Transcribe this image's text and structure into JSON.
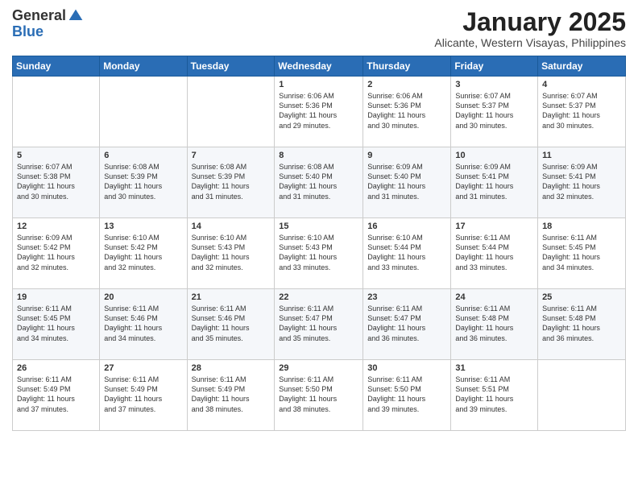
{
  "header": {
    "logo_line1": "General",
    "logo_line2": "Blue",
    "month": "January 2025",
    "location": "Alicante, Western Visayas, Philippines"
  },
  "weekdays": [
    "Sunday",
    "Monday",
    "Tuesday",
    "Wednesday",
    "Thursday",
    "Friday",
    "Saturday"
  ],
  "weeks": [
    [
      {
        "day": "",
        "info": ""
      },
      {
        "day": "",
        "info": ""
      },
      {
        "day": "",
        "info": ""
      },
      {
        "day": "1",
        "info": "Sunrise: 6:06 AM\nSunset: 5:36 PM\nDaylight: 11 hours\nand 29 minutes."
      },
      {
        "day": "2",
        "info": "Sunrise: 6:06 AM\nSunset: 5:36 PM\nDaylight: 11 hours\nand 30 minutes."
      },
      {
        "day": "3",
        "info": "Sunrise: 6:07 AM\nSunset: 5:37 PM\nDaylight: 11 hours\nand 30 minutes."
      },
      {
        "day": "4",
        "info": "Sunrise: 6:07 AM\nSunset: 5:37 PM\nDaylight: 11 hours\nand 30 minutes."
      }
    ],
    [
      {
        "day": "5",
        "info": "Sunrise: 6:07 AM\nSunset: 5:38 PM\nDaylight: 11 hours\nand 30 minutes."
      },
      {
        "day": "6",
        "info": "Sunrise: 6:08 AM\nSunset: 5:39 PM\nDaylight: 11 hours\nand 30 minutes."
      },
      {
        "day": "7",
        "info": "Sunrise: 6:08 AM\nSunset: 5:39 PM\nDaylight: 11 hours\nand 31 minutes."
      },
      {
        "day": "8",
        "info": "Sunrise: 6:08 AM\nSunset: 5:40 PM\nDaylight: 11 hours\nand 31 minutes."
      },
      {
        "day": "9",
        "info": "Sunrise: 6:09 AM\nSunset: 5:40 PM\nDaylight: 11 hours\nand 31 minutes."
      },
      {
        "day": "10",
        "info": "Sunrise: 6:09 AM\nSunset: 5:41 PM\nDaylight: 11 hours\nand 31 minutes."
      },
      {
        "day": "11",
        "info": "Sunrise: 6:09 AM\nSunset: 5:41 PM\nDaylight: 11 hours\nand 32 minutes."
      }
    ],
    [
      {
        "day": "12",
        "info": "Sunrise: 6:09 AM\nSunset: 5:42 PM\nDaylight: 11 hours\nand 32 minutes."
      },
      {
        "day": "13",
        "info": "Sunrise: 6:10 AM\nSunset: 5:42 PM\nDaylight: 11 hours\nand 32 minutes."
      },
      {
        "day": "14",
        "info": "Sunrise: 6:10 AM\nSunset: 5:43 PM\nDaylight: 11 hours\nand 32 minutes."
      },
      {
        "day": "15",
        "info": "Sunrise: 6:10 AM\nSunset: 5:43 PM\nDaylight: 11 hours\nand 33 minutes."
      },
      {
        "day": "16",
        "info": "Sunrise: 6:10 AM\nSunset: 5:44 PM\nDaylight: 11 hours\nand 33 minutes."
      },
      {
        "day": "17",
        "info": "Sunrise: 6:11 AM\nSunset: 5:44 PM\nDaylight: 11 hours\nand 33 minutes."
      },
      {
        "day": "18",
        "info": "Sunrise: 6:11 AM\nSunset: 5:45 PM\nDaylight: 11 hours\nand 34 minutes."
      }
    ],
    [
      {
        "day": "19",
        "info": "Sunrise: 6:11 AM\nSunset: 5:45 PM\nDaylight: 11 hours\nand 34 minutes."
      },
      {
        "day": "20",
        "info": "Sunrise: 6:11 AM\nSunset: 5:46 PM\nDaylight: 11 hours\nand 34 minutes."
      },
      {
        "day": "21",
        "info": "Sunrise: 6:11 AM\nSunset: 5:46 PM\nDaylight: 11 hours\nand 35 minutes."
      },
      {
        "day": "22",
        "info": "Sunrise: 6:11 AM\nSunset: 5:47 PM\nDaylight: 11 hours\nand 35 minutes."
      },
      {
        "day": "23",
        "info": "Sunrise: 6:11 AM\nSunset: 5:47 PM\nDaylight: 11 hours\nand 36 minutes."
      },
      {
        "day": "24",
        "info": "Sunrise: 6:11 AM\nSunset: 5:48 PM\nDaylight: 11 hours\nand 36 minutes."
      },
      {
        "day": "25",
        "info": "Sunrise: 6:11 AM\nSunset: 5:48 PM\nDaylight: 11 hours\nand 36 minutes."
      }
    ],
    [
      {
        "day": "26",
        "info": "Sunrise: 6:11 AM\nSunset: 5:49 PM\nDaylight: 11 hours\nand 37 minutes."
      },
      {
        "day": "27",
        "info": "Sunrise: 6:11 AM\nSunset: 5:49 PM\nDaylight: 11 hours\nand 37 minutes."
      },
      {
        "day": "28",
        "info": "Sunrise: 6:11 AM\nSunset: 5:49 PM\nDaylight: 11 hours\nand 38 minutes."
      },
      {
        "day": "29",
        "info": "Sunrise: 6:11 AM\nSunset: 5:50 PM\nDaylight: 11 hours\nand 38 minutes."
      },
      {
        "day": "30",
        "info": "Sunrise: 6:11 AM\nSunset: 5:50 PM\nDaylight: 11 hours\nand 39 minutes."
      },
      {
        "day": "31",
        "info": "Sunrise: 6:11 AM\nSunset: 5:51 PM\nDaylight: 11 hours\nand 39 minutes."
      },
      {
        "day": "",
        "info": ""
      }
    ]
  ]
}
